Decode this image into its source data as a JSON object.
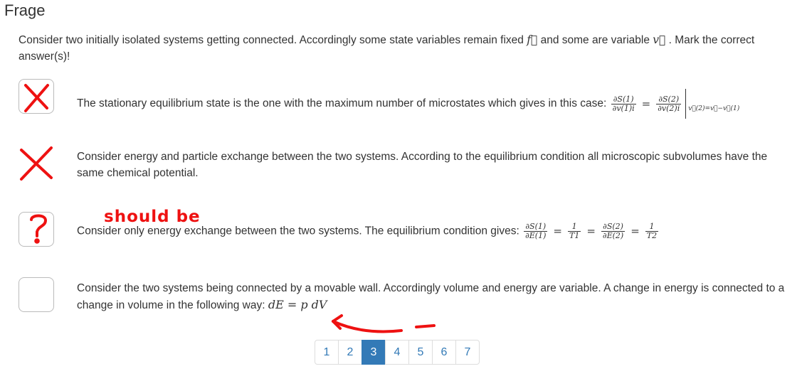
{
  "page_title": "Frage",
  "intro": {
    "text_before_f": "Consider two initially isolated systems getting connected. Accordingly some state variables remain fixed ",
    "f_symbol": "f⃗",
    "text_middle": " and some are variable ",
    "v_symbol": "v⃗",
    "text_after": " . Mark the correct answer(s)!"
  },
  "questions": [
    {
      "text": "The stationary equilibrium state is the one with the maximum number of microstates which gives in this case:",
      "formula": {
        "num1": "∂S(1)",
        "den1": "∂v(1)i",
        "eq": "=",
        "num2": "∂S(2)",
        "den2": "∂v(2)i",
        "sub": "v⃗(2)=v⃗−v⃗(1)"
      },
      "mark": "cross"
    },
    {
      "text": "Consider energy and particle exchange between the two systems. According to the equilibrium condition all microscopic subvolumes have the same chemical potential.",
      "mark": "cross"
    },
    {
      "text": "Consider only energy exchange between the two systems. The equilibrium condition gives:",
      "formula": {
        "f1n": "∂S(1)",
        "f1d": "∂E(1)",
        "f2n": "1",
        "f2d": "T1",
        "f3n": "∂S(2)",
        "f3d": "∂E(2)",
        "f4n": "1",
        "f4d": "T2",
        "eq": "="
      },
      "mark": "question",
      "annotation": "should be"
    },
    {
      "text": "Consider the two systems being connected by a movable wall. Accordingly volume and energy are variable. A change in energy is connected to a change in volume in the following way:",
      "formula": "dE = p dV",
      "mark": "none"
    }
  ],
  "pagination": {
    "pages": [
      "1",
      "2",
      "3",
      "4",
      "5",
      "6",
      "7"
    ],
    "active": "3"
  },
  "colors": {
    "annotation_red": "#ee1111",
    "link_blue": "#337ab7"
  }
}
